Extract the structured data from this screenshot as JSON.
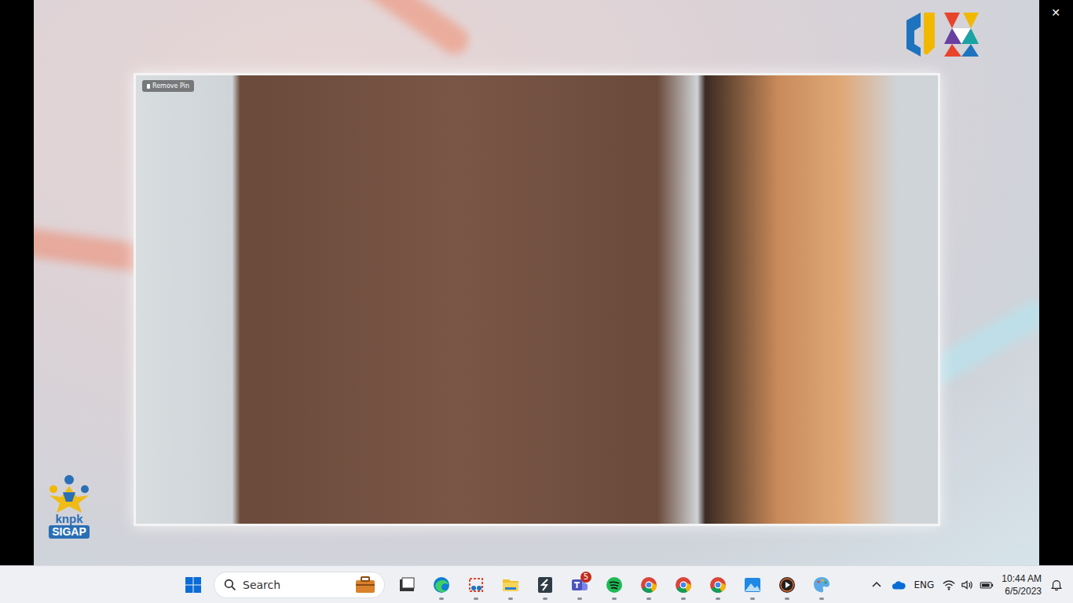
{
  "window": {
    "close_glyph": "✕"
  },
  "video": {
    "pin_label": "Remove Pin"
  },
  "brand": {
    "line1": "knpk",
    "line2": "SIGAP"
  },
  "taskbar": {
    "search_placeholder": "Search",
    "apps": [
      {
        "kind": "terminal",
        "running": false,
        "badge": ""
      },
      {
        "kind": "edge",
        "running": true,
        "badge": ""
      },
      {
        "kind": "snip",
        "running": true,
        "badge": ""
      },
      {
        "kind": "folder",
        "running": true,
        "badge": ""
      },
      {
        "kind": "sapp",
        "running": true,
        "badge": ""
      },
      {
        "kind": "teams",
        "running": true,
        "badge": "5"
      },
      {
        "kind": "spotify",
        "running": true,
        "badge": ""
      },
      {
        "kind": "chrome",
        "running": true,
        "badge": ""
      },
      {
        "kind": "chrome",
        "running": true,
        "badge": ""
      },
      {
        "kind": "chrome",
        "running": true,
        "badge": ""
      },
      {
        "kind": "photos",
        "running": true,
        "badge": ""
      },
      {
        "kind": "media",
        "running": true,
        "badge": ""
      },
      {
        "kind": "paint",
        "running": true,
        "badge": ""
      }
    ],
    "tray": {
      "language": "ENG",
      "time": "10:44 AM",
      "date": "6/5/2023"
    }
  }
}
